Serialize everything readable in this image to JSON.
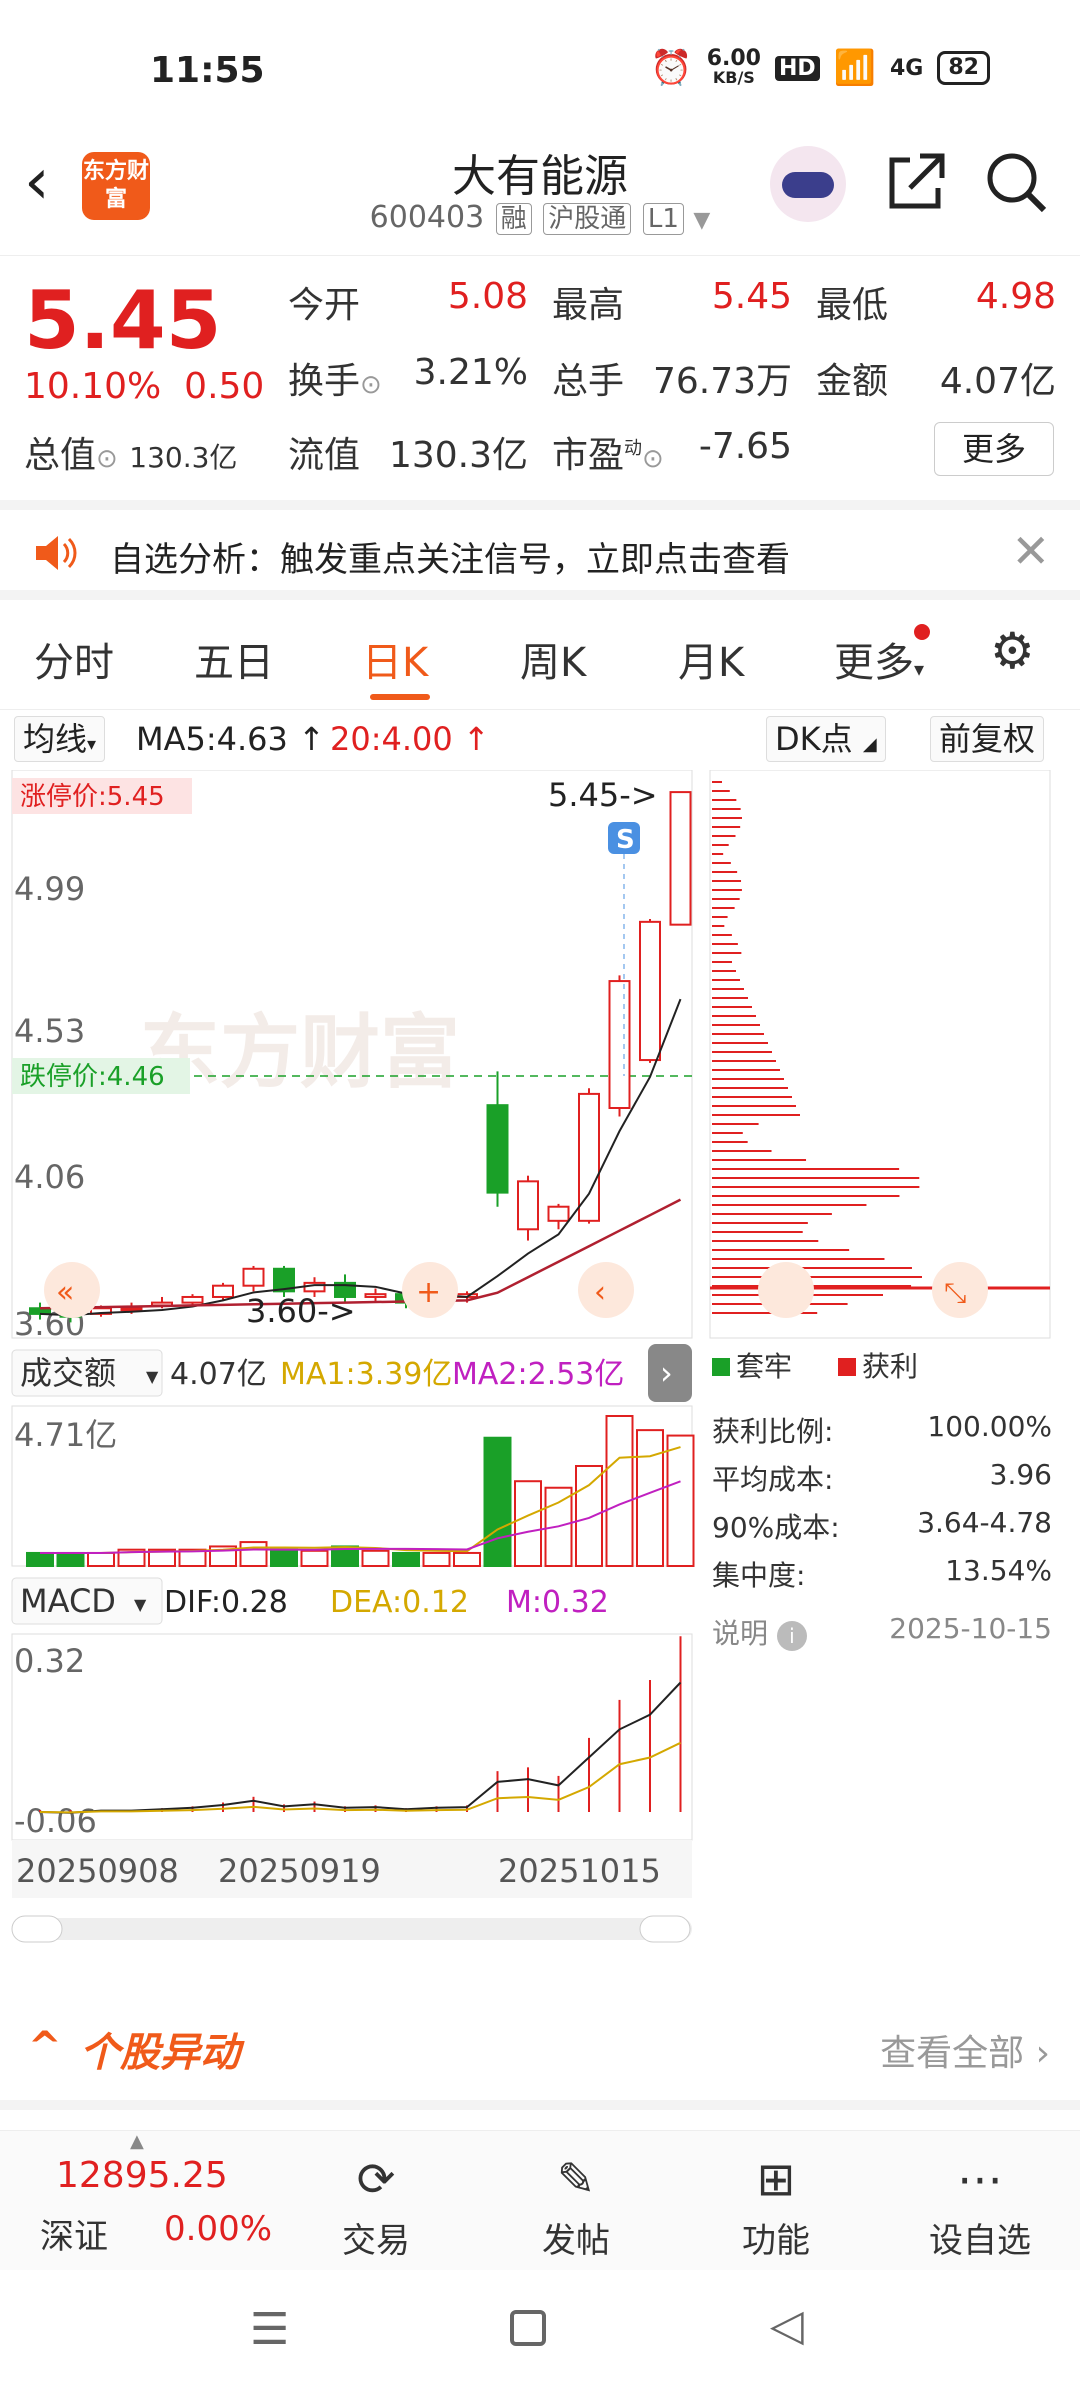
{
  "status": {
    "time": "11:55",
    "net": "6.00",
    "net_unit": "KB/S",
    "battery": "82",
    "sig": "4G"
  },
  "header": {
    "title": "大有能源",
    "code": "600403",
    "tags": [
      "融",
      "沪股通",
      "L1"
    ],
    "logo_text": "东方财富"
  },
  "quote": {
    "price": "5.45",
    "pct": "10.10%",
    "change": "0.50",
    "total_label": "总值",
    "total_val": "130.3亿",
    "open_label": "今开",
    "open": "5.08",
    "high_label": "最高",
    "high": "5.45",
    "low_label": "最低",
    "low": "4.98",
    "turnover_label": "换手",
    "turnover": "3.21%",
    "vol_label": "总手",
    "vol": "76.73万",
    "amt_label": "金额",
    "amt": "4.07亿",
    "float_label": "流值",
    "float": "130.3亿",
    "pe_label": "市盈",
    "pe_sup": "动",
    "pe": "-7.65",
    "more": "更多"
  },
  "banner": {
    "text": "自选分析：触发重点关注信号，立即点击查看"
  },
  "tabs": [
    "分时",
    "五日",
    "日K",
    "周K",
    "月K",
    "更多"
  ],
  "active_tab": "日K",
  "chart_toolbar": {
    "ma_select": "均线",
    "ma5": "MA5:4.63",
    "ma20": "20:4.00",
    "dk": "DK点",
    "adj": "前复权"
  },
  "kline": {
    "limit_up": "涨停价:5.45",
    "limit_down": "跌停价:4.46",
    "y_labels": [
      "4.99",
      "4.53",
      "4.06",
      "3.60"
    ],
    "top_label": "5.45->",
    "bot_label": "3.60->",
    "watermark": "东方财富",
    "s_badge": "S",
    "candles": [
      {
        "o": 3.62,
        "c": 3.6,
        "h": 3.64,
        "l": 3.58
      },
      {
        "o": 3.61,
        "c": 3.59,
        "h": 3.63,
        "l": 3.57
      },
      {
        "o": 3.6,
        "c": 3.62,
        "h": 3.63,
        "l": 3.59
      },
      {
        "o": 3.62,
        "c": 3.62,
        "h": 3.64,
        "l": 3.6
      },
      {
        "o": 3.63,
        "c": 3.64,
        "h": 3.66,
        "l": 3.62
      },
      {
        "o": 3.64,
        "c": 3.66,
        "h": 3.67,
        "l": 3.63
      },
      {
        "o": 3.66,
        "c": 3.7,
        "h": 3.71,
        "l": 3.65
      },
      {
        "o": 3.7,
        "c": 3.76,
        "h": 3.77,
        "l": 3.68
      },
      {
        "o": 3.76,
        "c": 3.68,
        "h": 3.77,
        "l": 3.66
      },
      {
        "o": 3.68,
        "c": 3.71,
        "h": 3.73,
        "l": 3.66
      },
      {
        "o": 3.71,
        "c": 3.66,
        "h": 3.74,
        "l": 3.64
      },
      {
        "o": 3.66,
        "c": 3.67,
        "h": 3.69,
        "l": 3.64
      },
      {
        "o": 3.67,
        "c": 3.64,
        "h": 3.69,
        "l": 3.62
      },
      {
        "o": 3.64,
        "c": 3.66,
        "h": 3.68,
        "l": 3.6
      },
      {
        "o": 3.66,
        "c": 3.67,
        "h": 3.68,
        "l": 3.64
      },
      {
        "o": 4.34,
        "c": 4.03,
        "h": 4.46,
        "l": 3.98
      },
      {
        "o": 3.9,
        "c": 4.07,
        "h": 4.09,
        "l": 3.86
      },
      {
        "o": 3.93,
        "c": 3.98,
        "h": 3.99,
        "l": 3.9
      },
      {
        "o": 3.93,
        "c": 4.38,
        "h": 4.4,
        "l": 3.92
      },
      {
        "o": 4.33,
        "c": 4.78,
        "h": 4.8,
        "l": 4.3
      },
      {
        "o": 4.5,
        "c": 4.99,
        "h": 5.0,
        "l": 4.49
      },
      {
        "o": 4.98,
        "c": 5.45,
        "h": 5.45,
        "l": 4.98
      }
    ],
    "ymin": 3.55,
    "ymax": 5.5
  },
  "volume": {
    "label": "成交额",
    "amt": "4.07亿",
    "ma1": "MA1:3.39亿",
    "ma2": "MA2:2.53亿",
    "ymax_label": "4.71亿",
    "values": [
      0.12,
      0.12,
      0.12,
      0.15,
      0.15,
      0.15,
      0.18,
      0.22,
      0.15,
      0.14,
      0.18,
      0.14,
      0.12,
      0.12,
      0.12,
      1.18,
      0.78,
      0.72,
      0.92,
      1.38,
      1.25,
      1.2
    ],
    "ymax": 1.38
  },
  "macd": {
    "label": "MACD",
    "dif": "DIF:0.28",
    "dea": "DEA:0.12",
    "m": "M:0.32",
    "top": "0.32",
    "bottom": "-0.06",
    "dates": [
      "20250908",
      "20250919",
      "20251015"
    ]
  },
  "chips": {
    "legend_trap": "套牢",
    "legend_profit": "获利",
    "rows": [
      {
        "k": "获利比例:",
        "v": "100.00%"
      },
      {
        "k": "平均成本:",
        "v": "3.96"
      },
      {
        "k": "90%成本:",
        "v": "3.64-4.78"
      },
      {
        "k": "集中度:",
        "v": "13.54%"
      }
    ],
    "note": "说明",
    "date": "2025-10-15"
  },
  "section": {
    "title": "个股异动",
    "more": "查看全部"
  },
  "bottom": {
    "index": "12895.25",
    "index_name": "深证",
    "index_pct": "0.00%",
    "items": [
      "交易",
      "发帖",
      "功能",
      "设自选"
    ]
  },
  "colors": {
    "up": "#e02020",
    "down": "#1aa028",
    "accent": "#f05a1a"
  }
}
